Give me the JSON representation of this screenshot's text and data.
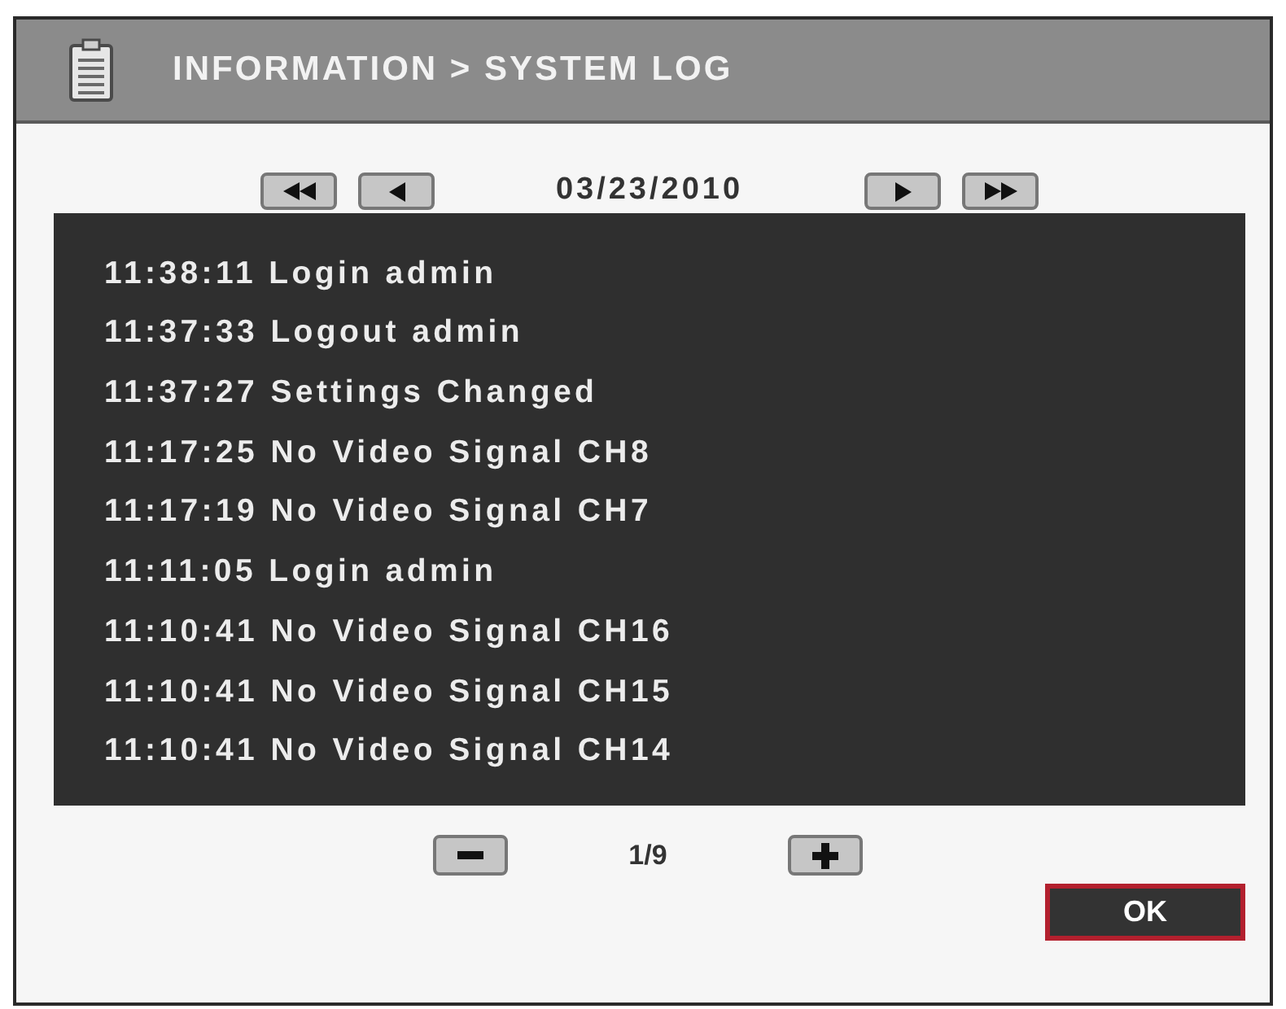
{
  "window": {
    "title": "INFORMATION > SYSTEM LOG"
  },
  "date_navigation": {
    "date": "03/23/2010"
  },
  "log": {
    "entries": [
      "11:38:11 Login admin",
      "11:37:33 Logout admin",
      "11:37:27 Settings Changed",
      "11:17:25 No Video Signal CH8",
      "11:17:19 No Video Signal CH7",
      "11:11:05 Login admin",
      "11:10:41 No Video Signal CH16",
      "11:10:41 No Video Signal CH15",
      "11:10:41 No Video Signal CH14"
    ]
  },
  "pager": {
    "page": "1/9"
  },
  "buttons": [
    {
      "label": "OK",
      "focused": true
    }
  ]
}
